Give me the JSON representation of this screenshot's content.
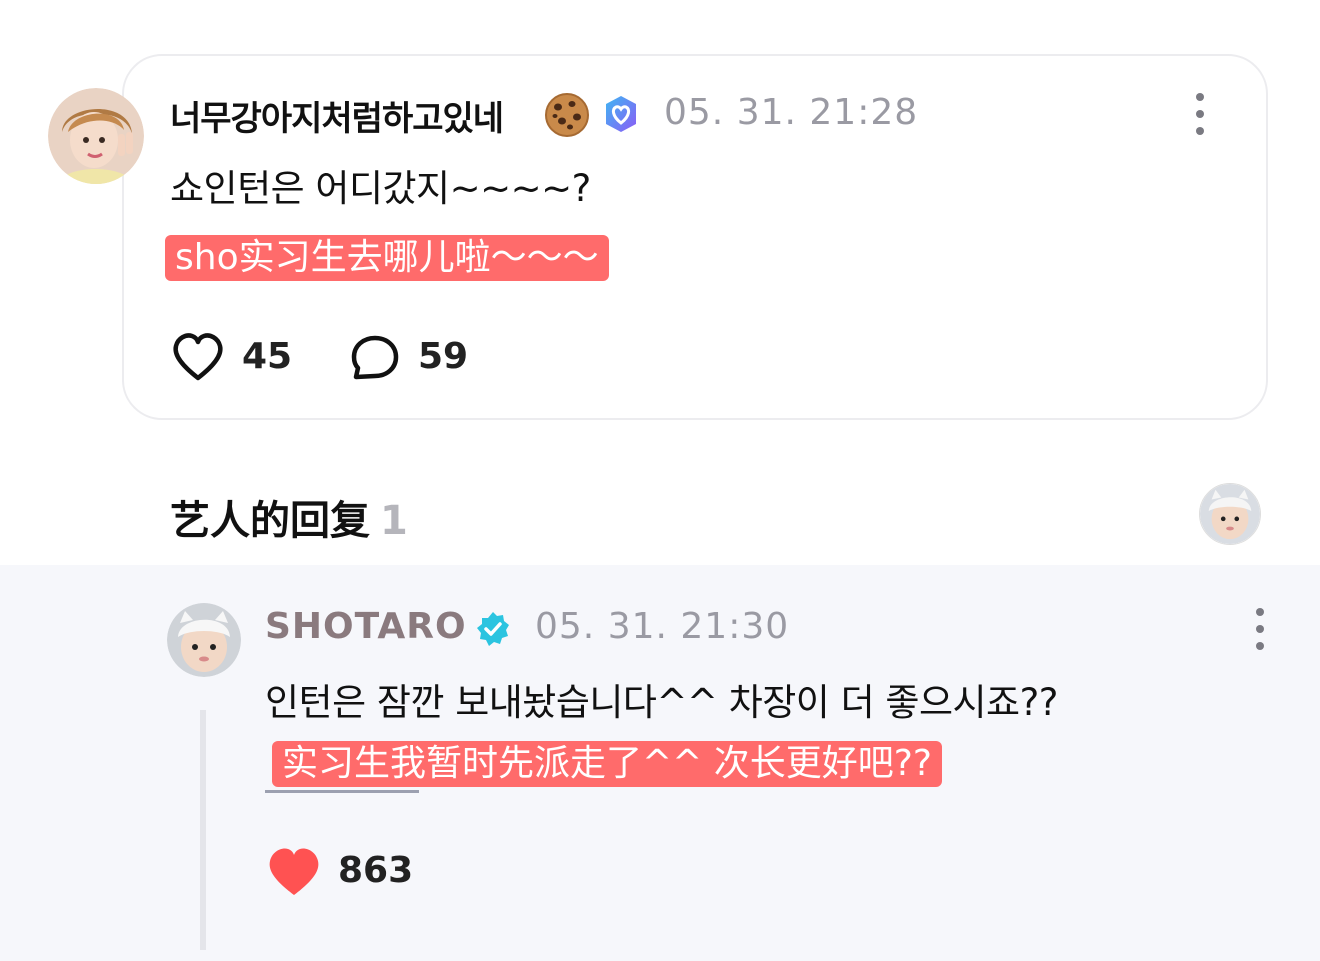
{
  "fan_post": {
    "username": "너무강아지처럼하고있네",
    "timestamp": "05. 31. 21:28",
    "content": "쇼인턴은 어디갔지~~~~?",
    "translation": "sho实习生去哪儿啦～～～",
    "likes": "45",
    "comments": "59",
    "icons": {
      "badge_emoji": "cookie-icon",
      "verified": "membership-heart-badge-icon",
      "like": "heart-outline-icon",
      "comment": "comment-bubble-icon",
      "more": "more-vertical-icon"
    }
  },
  "section": {
    "title": "艺人的回复",
    "count": "1"
  },
  "artist_reply": {
    "username": "SHOTARO",
    "timestamp": "05. 31. 21:30",
    "content": "인턴은 잠깐 보내놨습니다^^ 차장이 더 좋으시죠??",
    "translation": "实习生我暂时先派走了^^ 次长更好吧??",
    "likes": "863",
    "icons": {
      "verified": "verified-check-badge-icon",
      "like": "heart-filled-icon",
      "more": "more-vertical-icon"
    }
  },
  "colors": {
    "translation_bg": "#ff6b6b",
    "liked_heart": "#ff5252",
    "verified_blue": "#2bc4e0",
    "artist_name": "#8a7a7e",
    "timestamp": "#9a9aa3",
    "reply_bg": "#f6f7fb"
  }
}
